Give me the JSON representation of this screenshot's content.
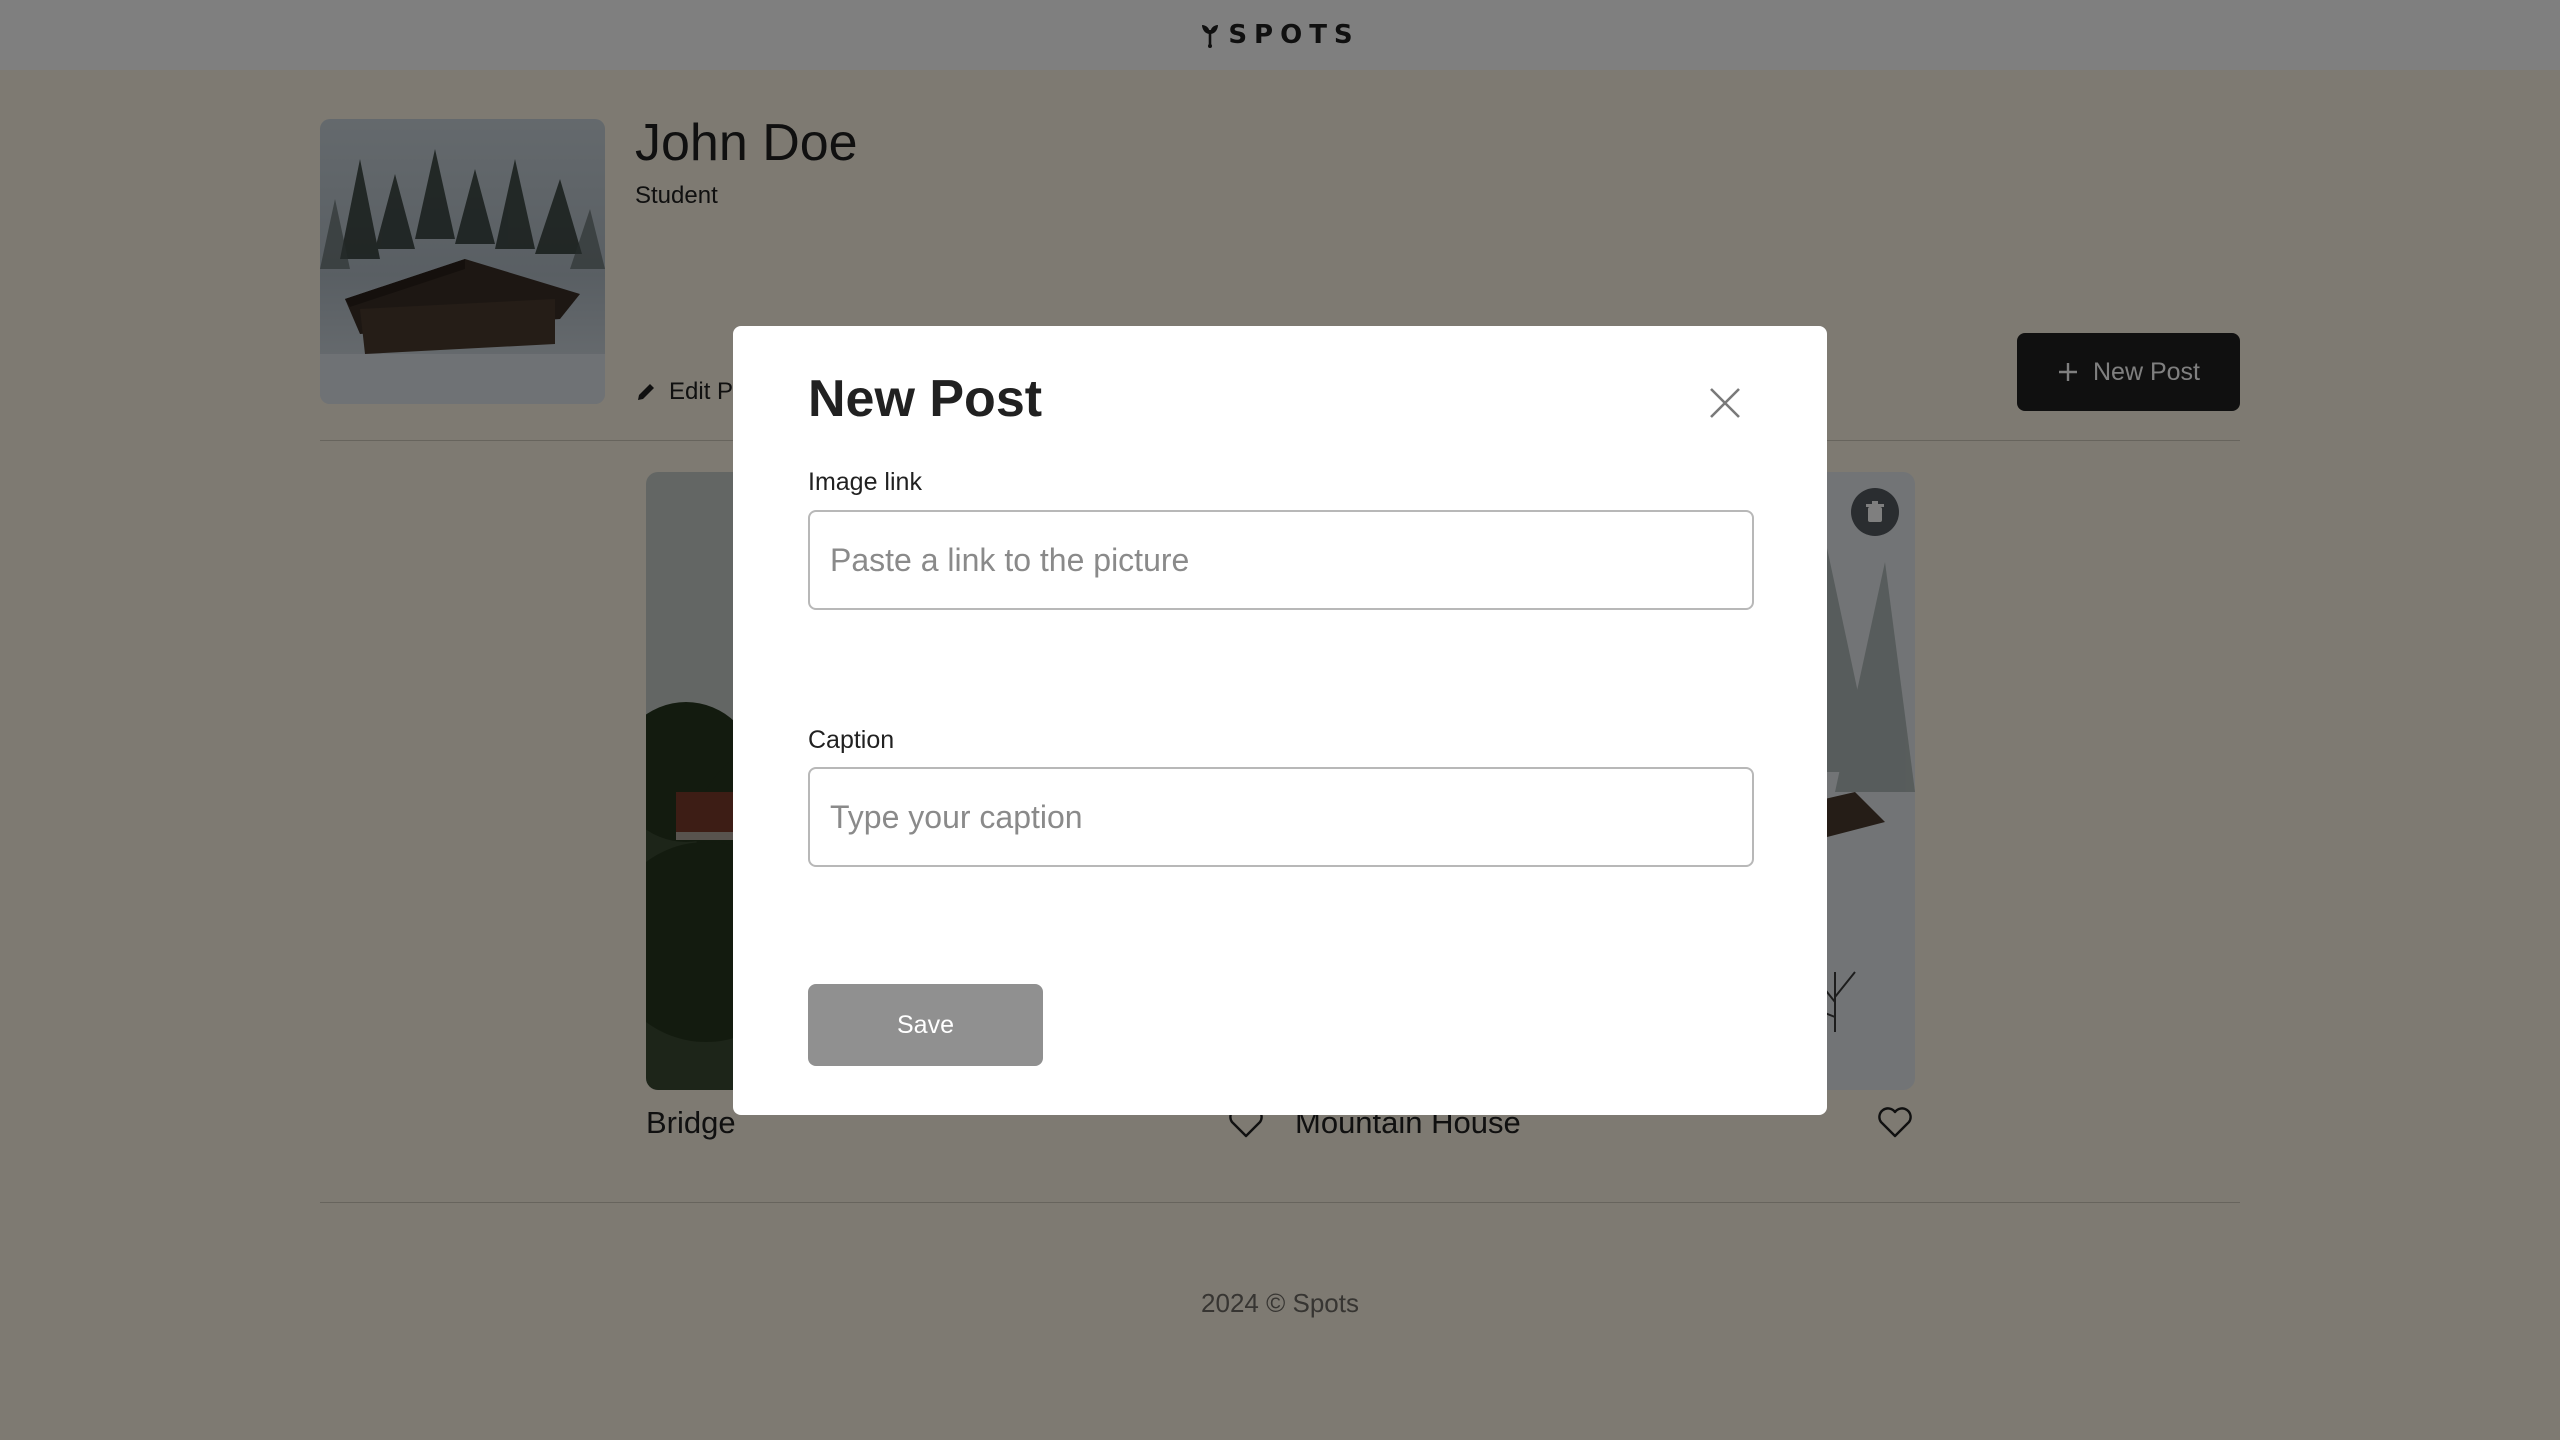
{
  "header": {
    "logo_text": "SPOTS",
    "logo_icon": "sprout-icon"
  },
  "profile": {
    "name": "John Doe",
    "role": "Student",
    "edit_label": "Edit Profile",
    "new_post_label": "New Post"
  },
  "cards": [
    {
      "title": "Bridge",
      "liked": false
    },
    {
      "title": "Mountain House",
      "liked": false
    }
  ],
  "footer": {
    "text": "2024 © Spots"
  },
  "modal": {
    "title": "New Post",
    "image_link_label": "Image link",
    "image_link_placeholder": "Paste a link to the picture",
    "caption_label": "Caption",
    "caption_placeholder": "Type your caption",
    "save_label": "Save"
  },
  "colors": {
    "page_background": "#fcf5e5",
    "text_primary": "#212121",
    "overlay": "rgba(0,0,0,0.5)",
    "save_disabled": "#909090"
  }
}
